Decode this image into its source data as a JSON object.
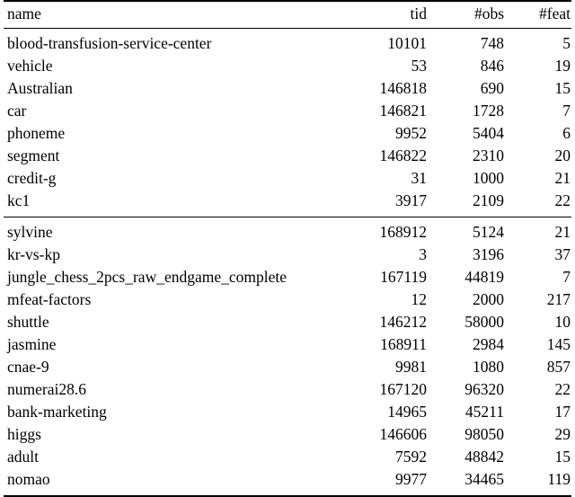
{
  "table": {
    "columns": [
      {
        "key": "name",
        "label": "name",
        "align": "left"
      },
      {
        "key": "tid",
        "label": "tid",
        "align": "right"
      },
      {
        "key": "obs",
        "label": "#obs",
        "align": "right"
      },
      {
        "key": "feat",
        "label": "#feat",
        "align": "right"
      }
    ],
    "groups": [
      {
        "rows": [
          {
            "name": "blood-transfusion-service-center",
            "tid": "10101",
            "obs": "748",
            "feat": "5"
          },
          {
            "name": "vehicle",
            "tid": "53",
            "obs": "846",
            "feat": "19"
          },
          {
            "name": "Australian",
            "tid": "146818",
            "obs": "690",
            "feat": "15"
          },
          {
            "name": "car",
            "tid": "146821",
            "obs": "1728",
            "feat": "7"
          },
          {
            "name": "phoneme",
            "tid": "9952",
            "obs": "5404",
            "feat": "6"
          },
          {
            "name": "segment",
            "tid": "146822",
            "obs": "2310",
            "feat": "20"
          },
          {
            "name": "credit-g",
            "tid": "31",
            "obs": "1000",
            "feat": "21"
          },
          {
            "name": "kc1",
            "tid": "3917",
            "obs": "2109",
            "feat": "22"
          }
        ]
      },
      {
        "rows": [
          {
            "name": "sylvine",
            "tid": "168912",
            "obs": "5124",
            "feat": "21"
          },
          {
            "name": "kr-vs-kp",
            "tid": "3",
            "obs": "3196",
            "feat": "37"
          },
          {
            "name": "jungle_chess_2pcs_raw_endgame_complete",
            "tid": "167119",
            "obs": "44819",
            "feat": "7"
          },
          {
            "name": "mfeat-factors",
            "tid": "12",
            "obs": "2000",
            "feat": "217"
          },
          {
            "name": "shuttle",
            "tid": "146212",
            "obs": "58000",
            "feat": "10"
          },
          {
            "name": "jasmine",
            "tid": "168911",
            "obs": "2984",
            "feat": "145"
          },
          {
            "name": "cnae-9",
            "tid": "9981",
            "obs": "1080",
            "feat": "857"
          },
          {
            "name": "numerai28.6",
            "tid": "167120",
            "obs": "96320",
            "feat": "22"
          },
          {
            "name": "bank-marketing",
            "tid": "14965",
            "obs": "45211",
            "feat": "17"
          },
          {
            "name": "higgs",
            "tid": "146606",
            "obs": "98050",
            "feat": "29"
          },
          {
            "name": "adult",
            "tid": "7592",
            "obs": "48842",
            "feat": "15"
          },
          {
            "name": "nomao",
            "tid": "9977",
            "obs": "34465",
            "feat": "119"
          }
        ]
      }
    ]
  }
}
